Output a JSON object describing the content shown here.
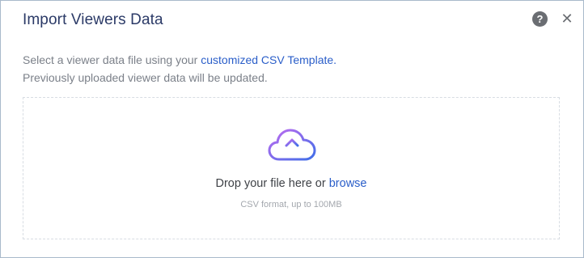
{
  "dialog": {
    "title": "Import Viewers Data",
    "help_icon": "question-circle-icon",
    "help_glyph": "?",
    "close_icon": "close-icon",
    "close_glyph": "✕"
  },
  "description": {
    "line1_prefix": "Select a viewer data file using your ",
    "line1_link": "customized CSV Template.",
    "line2": "Previously uploaded viewer data will be updated."
  },
  "dropzone": {
    "icon": "cloud-upload-icon",
    "prompt_prefix": "Drop your file here or ",
    "browse_link": "browse",
    "hint": "CSV format, up to 100MB"
  },
  "colors": {
    "title": "#2b3a67",
    "link": "#2a5ec9",
    "text_muted": "#7b8089",
    "icon_grey": "#6a6d72",
    "cloud_gradient_start": "#c06bf0",
    "cloud_gradient_end": "#3f6ee8"
  }
}
